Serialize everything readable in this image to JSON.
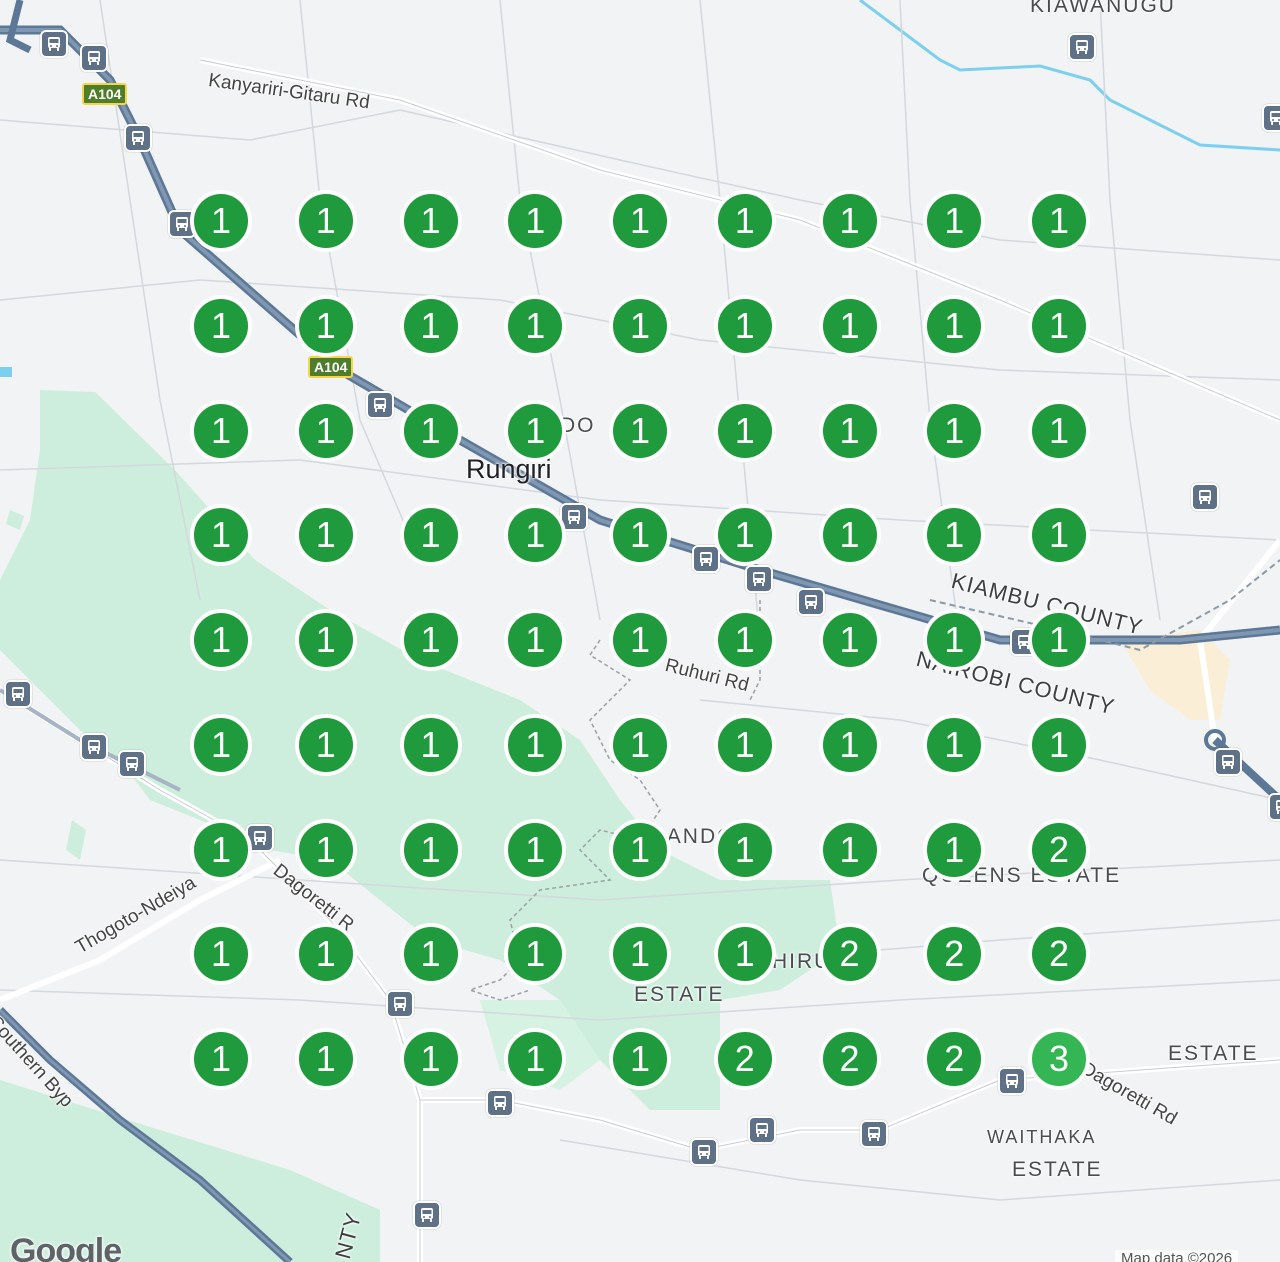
{
  "map": {
    "labels": {
      "kiawanugu": "KIAWANUGU",
      "kanyariri_rd": "Kanyariri-Gitaru Rd",
      "rungiri": "Rungiri",
      "rungiri_partial": "DO",
      "kiambu_county": "KIAMBU COUNTY",
      "nairobi_county": "NAIROBI COUNTY",
      "ruhuri_rd": "Ruhuri Rd",
      "thogoto_rd": "Thogoto-Ndeiya",
      "dagoretti_rd": "Dagoretti R",
      "southern_byp": "Southern Byp",
      "queens_estate": "QUEENS ESTATE",
      "estate_mid": "ESTATE",
      "hiru_partial": "HIRU",
      "ngando_partial": "YAGANDO",
      "estate_right": "ESTATE",
      "waithaka": "WAITHAKA",
      "waithaka_estate": "ESTATE",
      "dagoretti_rd_right": "Dagoretti Rd",
      "county_bottom": "NTY"
    },
    "shields": {
      "top": "A104",
      "mid": "A104"
    },
    "bus_icon": "bus-stop-icon",
    "colors": {
      "marker_green": "#1f9a3c",
      "marker_light_green": "#33b653",
      "park_green": "#cdeedd",
      "highway": "#5c7896",
      "river": "#7ccfef"
    },
    "logo": "Google",
    "attribution": "Map data ©2026"
  },
  "clusters": [
    [
      1,
      1,
      1,
      1,
      1,
      1,
      1,
      1,
      1
    ],
    [
      1,
      1,
      1,
      1,
      1,
      1,
      1,
      1,
      1
    ],
    [
      1,
      1,
      1,
      1,
      1,
      1,
      1,
      1,
      1
    ],
    [
      1,
      1,
      1,
      1,
      1,
      1,
      1,
      1,
      1
    ],
    [
      1,
      1,
      1,
      1,
      1,
      1,
      1,
      1,
      1
    ],
    [
      1,
      1,
      1,
      1,
      1,
      1,
      1,
      1,
      1
    ],
    [
      1,
      1,
      1,
      1,
      1,
      1,
      1,
      1,
      2
    ],
    [
      1,
      1,
      1,
      1,
      1,
      1,
      2,
      2,
      2
    ],
    [
      1,
      1,
      1,
      1,
      1,
      2,
      2,
      2,
      3
    ]
  ]
}
